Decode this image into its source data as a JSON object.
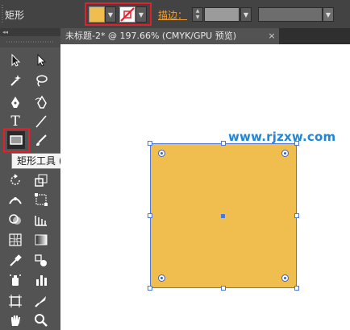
{
  "control_bar": {
    "title": "矩形",
    "fill_color": "#f0be4f",
    "stroke_label": "描边：",
    "dropdown_arrow": "▼"
  },
  "document_tab": {
    "label": "未标题-2* @ 197.66% (CMYK/GPU 预览)",
    "close": "×"
  },
  "tools_panel": {
    "collapse": "◂◂",
    "type_tool": "T",
    "tooltip": "矩形工具 (M)"
  },
  "canvas": {
    "watermark": "www.rjzxw.com",
    "rect_fill": "#f0be4f",
    "selection_color": "#4a78d8"
  },
  "icons": [
    "selection-icon",
    "direct-selection-icon",
    "magic-wand-icon",
    "lasso-icon",
    "pen-icon",
    "curvature-icon",
    "type-icon",
    "line-icon",
    "rectangle-icon",
    "paintbrush-icon",
    "shaper-icon",
    "eraser-icon",
    "rotate-icon",
    "scale-icon",
    "width-icon",
    "free-transform-icon",
    "shape-builder-icon",
    "perspective-icon",
    "mesh-icon",
    "gradient-icon",
    "eyedropper-icon",
    "blend-icon",
    "symbol-sprayer-icon",
    "column-graph-icon",
    "artboard-icon",
    "slice-icon",
    "hand-icon",
    "zoom-icon"
  ]
}
